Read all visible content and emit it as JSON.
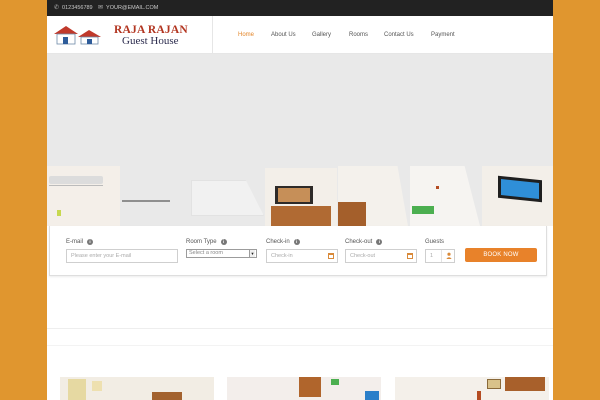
{
  "topbar": {
    "phone_icon": "phone-icon",
    "phone": "0123456789",
    "email_icon": "envelope-icon",
    "email": "YOUR@EMAIL.COM"
  },
  "logo": {
    "line1": "RAJA RAJAN",
    "line2": "Guest House"
  },
  "nav": {
    "items": [
      {
        "label": "Home",
        "active": true
      },
      {
        "label": "About Us",
        "active": false
      },
      {
        "label": "Gallery",
        "active": false
      },
      {
        "label": "Rooms",
        "active": false
      },
      {
        "label": "Contact Us",
        "active": false
      },
      {
        "label": "Payment",
        "active": false
      }
    ]
  },
  "booking": {
    "email": {
      "label": "E-mail",
      "placeholder": "Please enter your E-mail"
    },
    "room_type": {
      "label": "Room Type",
      "value": "Select a room"
    },
    "checkin": {
      "label": "Check-in",
      "placeholder": "Check-in"
    },
    "checkout": {
      "label": "Check-out",
      "placeholder": "Check-out"
    },
    "guests": {
      "label": "Guests",
      "value": "1"
    },
    "button": "BOOK NOW"
  },
  "colors": {
    "background": "#e0962f",
    "accent": "#e8822a",
    "topbar": "#222222",
    "logo_red": "#b23520"
  }
}
